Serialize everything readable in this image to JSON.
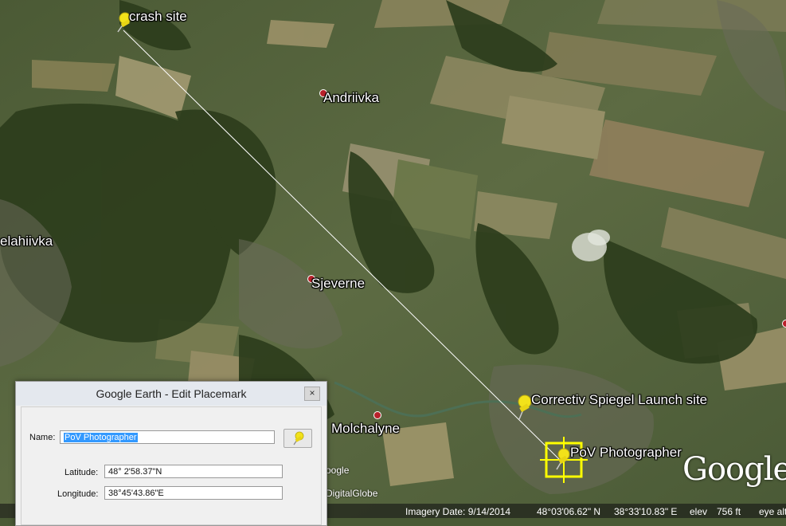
{
  "places": {
    "andriivka": "Andriivka",
    "elahiivka": "elahiivka",
    "sjeverne": "Sjeverne",
    "molchalyne": "Molchalyne"
  },
  "placemarks": {
    "crash_site": "crash site",
    "launch_site": "Correctiv Spiegel Launch site",
    "pov": "PoV Photographer"
  },
  "credits": {
    "google_small": "oogle",
    "digitalglobe": "DigitalGlobe",
    "google_logo": "Google"
  },
  "status_bar": {
    "imagery_date": "Imagery Date: 9/14/2014",
    "lat": "48°03'06.62\" N",
    "lon": "38°33'10.83\" E",
    "elev_label": "elev",
    "elev_value": "756 ft",
    "eye_alt": "eye alt"
  },
  "dialog": {
    "title": "Google Earth - Edit Placemark",
    "close": "×",
    "name_label": "Name:",
    "name_value": "PoV Photographer",
    "latitude_label": "Latitude:",
    "latitude_value": "48° 2'58.37\"N",
    "longitude_label": "Longitude:",
    "longitude_value": "38°45'43.86\"E"
  },
  "colors": {
    "pin_yellow": "#f2e21a",
    "town_dot": "#b8202a",
    "selection": "#ffff00",
    "path_line": "#ffffff"
  }
}
